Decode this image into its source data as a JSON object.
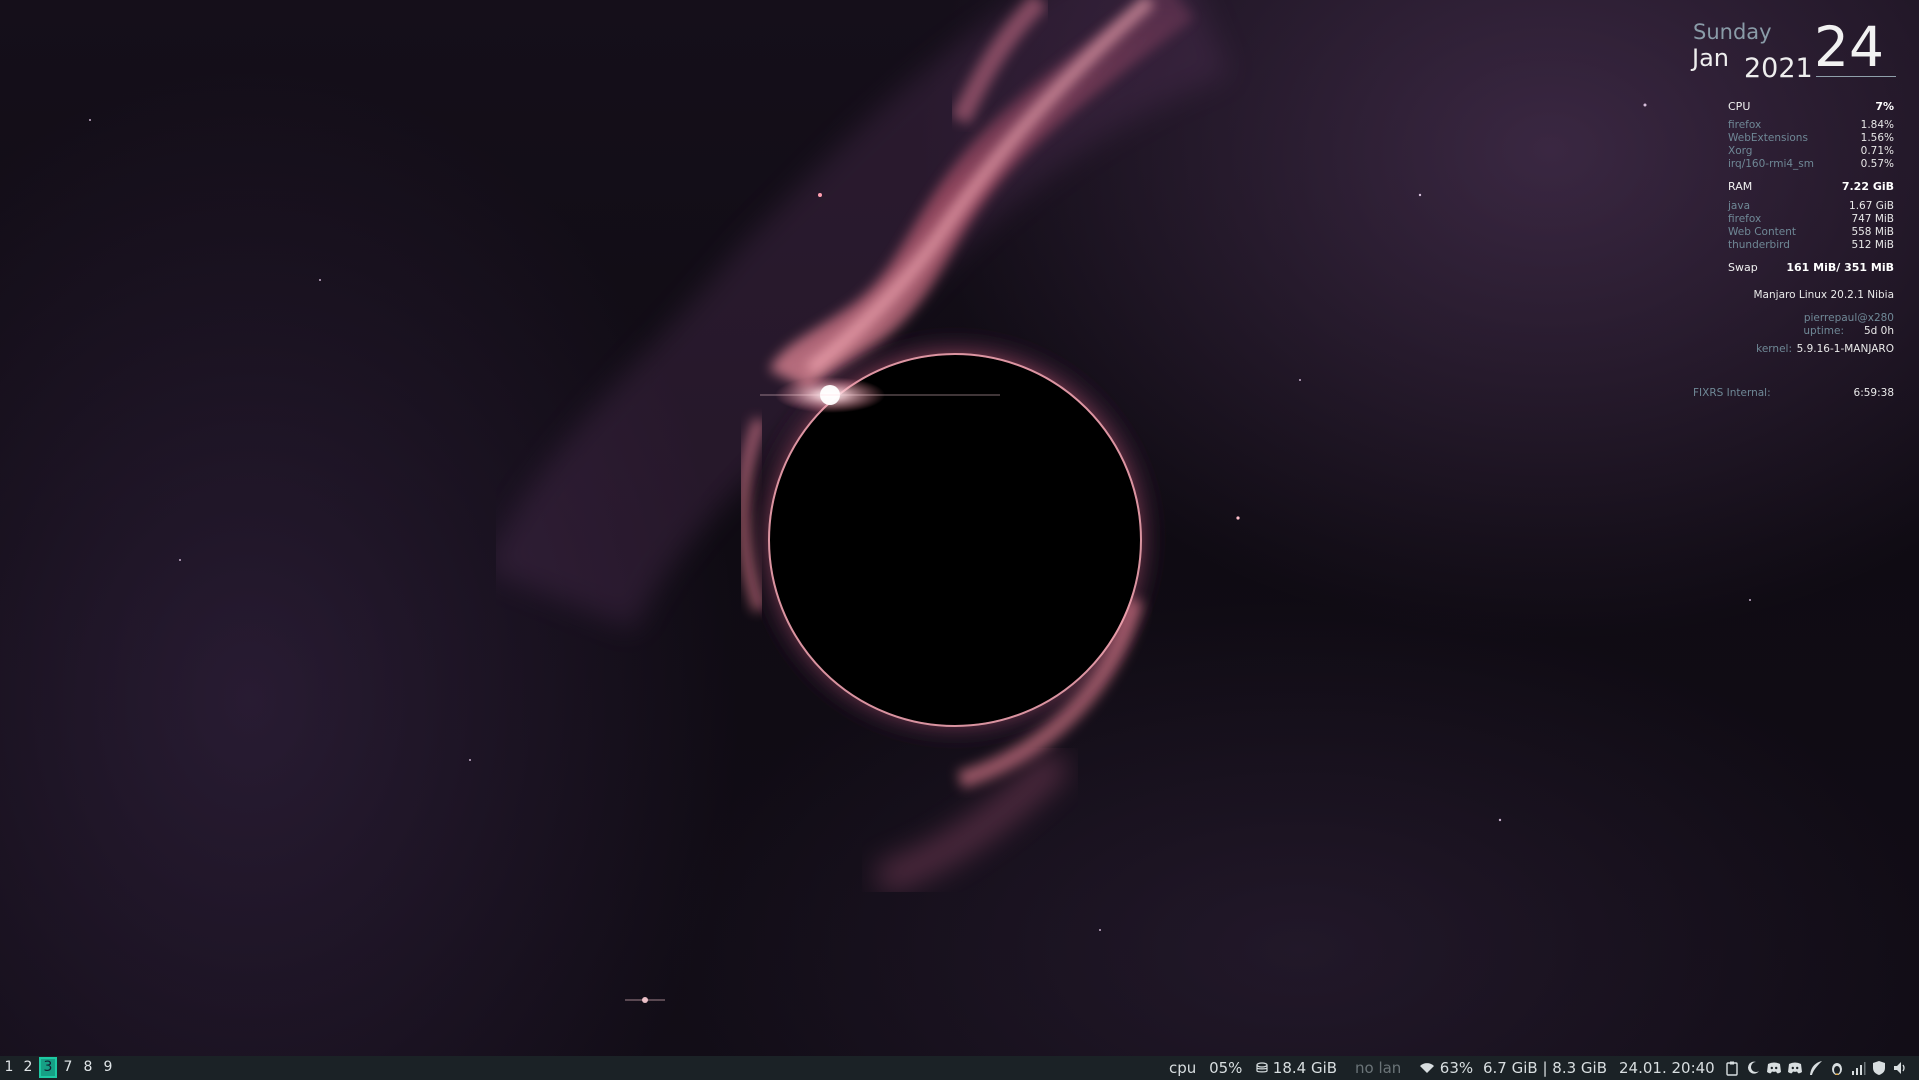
{
  "conky": {
    "day_name": "Sunday",
    "month": "Jan",
    "year": "2021",
    "day_number": "24",
    "cpu": {
      "label": "CPU",
      "total": "7%",
      "processes": [
        {
          "name": "firefox",
          "value": "1.84%"
        },
        {
          "name": "WebExtensions",
          "value": "1.56%"
        },
        {
          "name": "Xorg",
          "value": "0.71%"
        },
        {
          "name": "irq/160-rmi4_sm",
          "value": "0.57%"
        }
      ]
    },
    "ram": {
      "label": "RAM",
      "total": "7.22 GiB",
      "processes": [
        {
          "name": "java",
          "value": "1.67 GiB"
        },
        {
          "name": "firefox",
          "value": "747 MiB"
        },
        {
          "name": "Web Content",
          "value": "558 MiB"
        },
        {
          "name": "thunderbird",
          "value": "512 MiB"
        }
      ]
    },
    "swap": {
      "label": "Swap",
      "value": "161 MiB/ 351 MiB"
    },
    "system": {
      "distro": "Manjaro Linux 20.2.1 Nibia",
      "user_host": "pierrepaul@x280",
      "uptime_label": "uptime:",
      "uptime_value": "5d 0h",
      "kernel_label": "kernel:",
      "kernel_value": "5.9.16-1-MANJARO"
    },
    "timer": {
      "label": "FIXRS Internal:",
      "value": "6:59:38"
    }
  },
  "taskbar": {
    "workspaces": [
      {
        "label": "1",
        "active": false
      },
      {
        "label": "2",
        "active": false
      },
      {
        "label": "3",
        "active": true
      },
      {
        "label": "7",
        "active": false
      },
      {
        "label": "8",
        "active": false
      },
      {
        "label": "9",
        "active": false
      }
    ],
    "cpu_label": "cpu",
    "cpu_value": "05%",
    "disk": "18.4 GiB",
    "lan": "no lan",
    "wifi_strength": "63%",
    "memory": "6.7 GiB | 8.3 GiB",
    "datetime": "24.01. 20:40",
    "tray_icons": [
      "clipboard-icon",
      "moon-icon",
      "discord-icon",
      "discord-icon",
      "feather-icon",
      "penguin-icon",
      "signal-icon",
      "shield-icon",
      "volume-icon"
    ]
  },
  "colors": {
    "bar_background": "#1b2226",
    "active_workspace": "#16a085",
    "conky_label": "#6f8896",
    "wallpaper_glow": "#ff7a8c"
  }
}
